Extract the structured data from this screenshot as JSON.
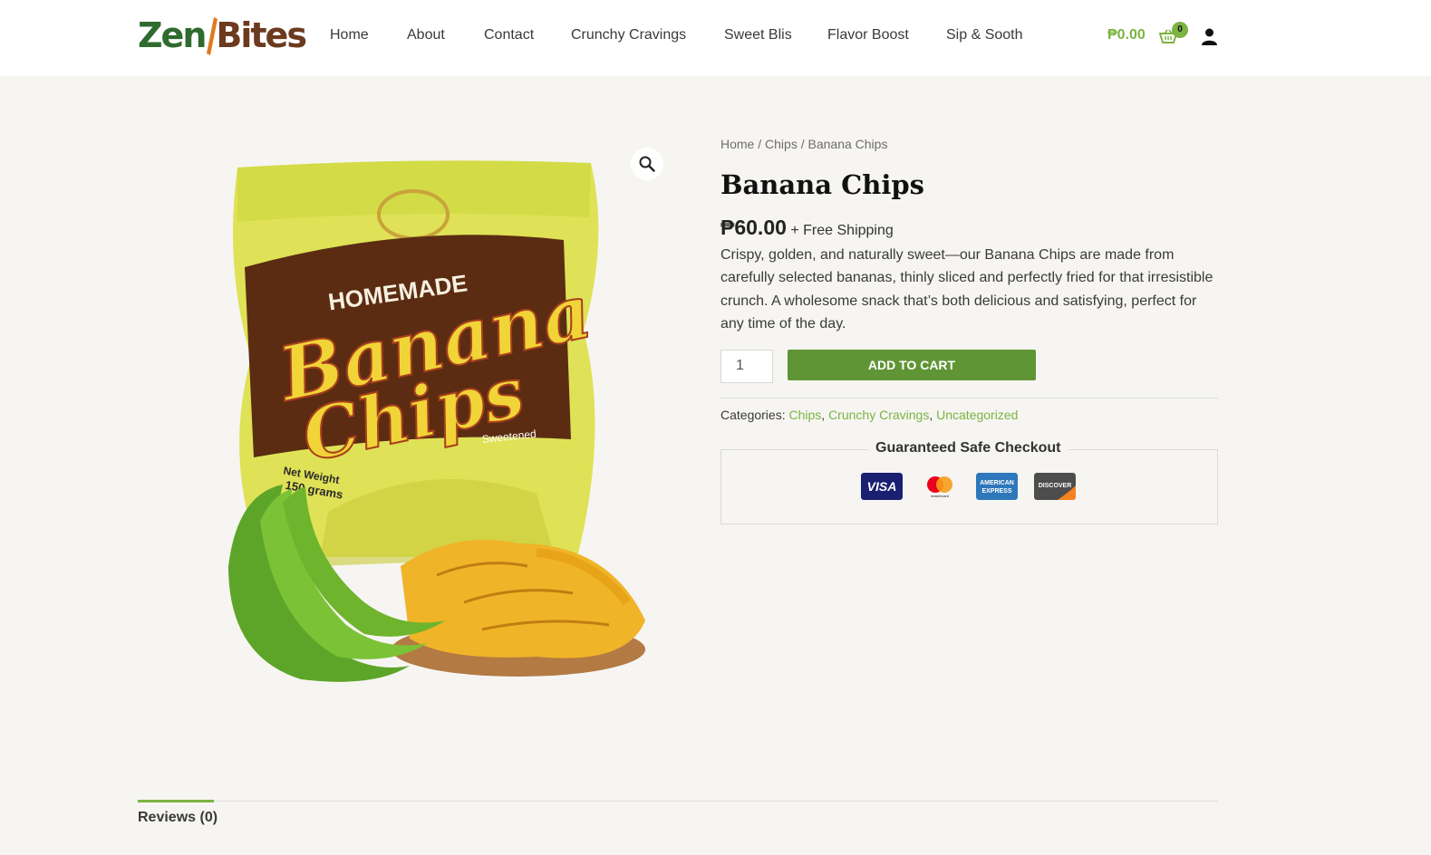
{
  "header": {
    "logo": {
      "part1": "Zen",
      "part2": "Bites"
    },
    "nav": [
      "Home",
      "About",
      "Contact",
      "Crunchy Cravings",
      "Sweet Blis",
      "Flavor Boost",
      "Sip & Sooth"
    ],
    "cart_total": "₱0.00",
    "cart_count": "0"
  },
  "breadcrumb": {
    "home": "Home",
    "sep": " / ",
    "category": "Chips",
    "current": "Banana Chips"
  },
  "product": {
    "title": "Banana Chips",
    "price": "₱60.00",
    "shipping": "+ Free Shipping",
    "description": "Crispy, golden, and naturally sweet—our Banana Chips are made from carefully selected bananas, thinly sliced and perfectly fried for that irresistible crunch. A wholesome snack that’s both delicious and satisfying, perfect for any time of the day.",
    "quantity": "1",
    "add_to_cart": "ADD TO CART",
    "categories_label": "Categories:",
    "categories": [
      "Chips",
      "Crunchy Cravings",
      "Uncategorized"
    ],
    "package_text": {
      "line1": "HOMEMADE",
      "line2": "Banana",
      "line3": "Chips",
      "sweet": "Sweetened",
      "weight1": "Net Weight",
      "weight2": "150 grams"
    }
  },
  "checkout": {
    "title": "Guaranteed Safe Checkout",
    "cards": [
      {
        "name": "VISA",
        "icon": "visa-icon",
        "color": "#1a1f71"
      },
      {
        "name": "mastercard",
        "icon": "mastercard-icon",
        "color": "#ffffff"
      },
      {
        "name": "AMERICAN EXPRESS",
        "icon": "amex-icon",
        "color": "#2e77bb"
      },
      {
        "name": "DISCOVER",
        "icon": "discover-icon",
        "color": "#4d4d4d"
      }
    ]
  },
  "tabs": {
    "reviews": "Reviews (0)"
  },
  "colors": {
    "accent": "#7cb342",
    "button": "#5f9535",
    "background": "#f6f5f2",
    "header": "#ffffff"
  }
}
